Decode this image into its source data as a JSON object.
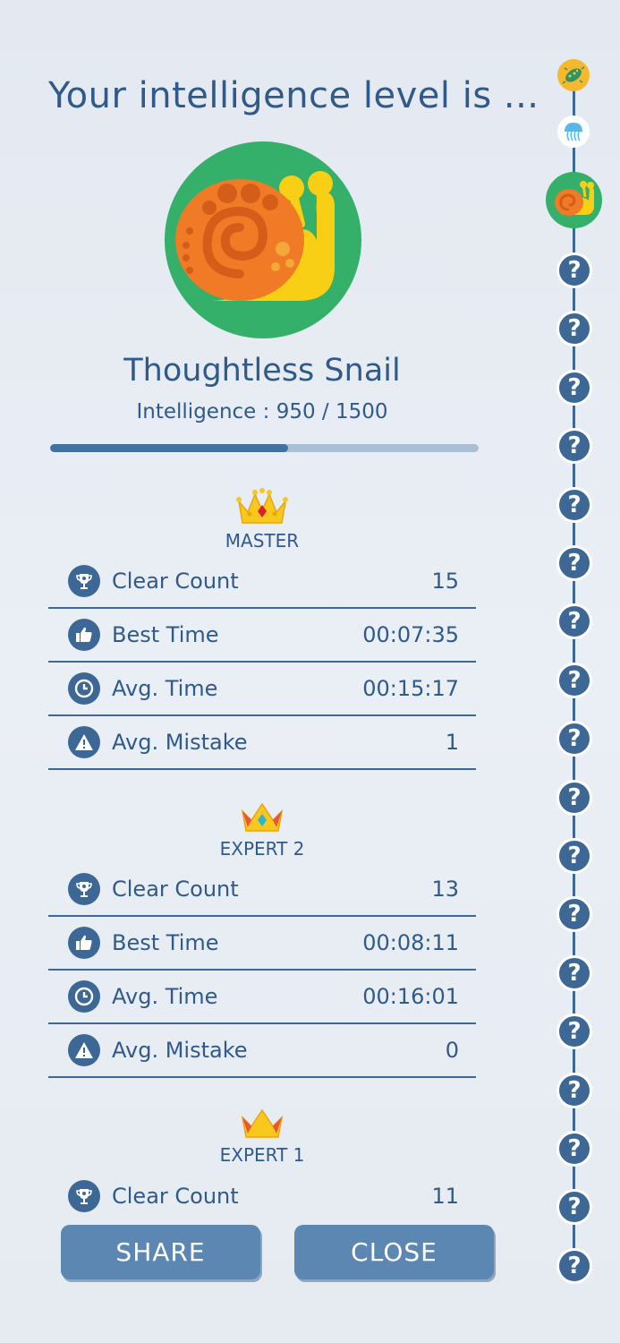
{
  "header": {
    "title": "Your intelligence level is ..."
  },
  "rank": {
    "name": "Thoughtless Snail",
    "intelligence_line": "Intelligence : 950 / 1500",
    "progress": 0.5556
  },
  "sections": [
    {
      "label": "MASTER",
      "crown": "master-crown",
      "stats": [
        {
          "icon": "trophy-icon",
          "label": "Clear Count",
          "value": "15"
        },
        {
          "icon": "thumbs-up-icon",
          "label": "Best Time",
          "value": "00:07:35"
        },
        {
          "icon": "clock-icon",
          "label": "Avg. Time",
          "value": "00:15:17"
        },
        {
          "icon": "warning-icon",
          "label": "Avg. Mistake",
          "value": "1"
        }
      ]
    },
    {
      "label": "EXPERT 2",
      "crown": "expert-2-crown",
      "stats": [
        {
          "icon": "trophy-icon",
          "label": "Clear Count",
          "value": "13"
        },
        {
          "icon": "thumbs-up-icon",
          "label": "Best Time",
          "value": "00:08:11"
        },
        {
          "icon": "clock-icon",
          "label": "Avg. Time",
          "value": "00:16:01"
        },
        {
          "icon": "warning-icon",
          "label": "Avg. Mistake",
          "value": "0"
        }
      ]
    },
    {
      "label": "EXPERT 1",
      "crown": "expert-1-crown",
      "stats": [
        {
          "icon": "trophy-icon",
          "label": "Clear Count",
          "value": "11"
        }
      ]
    }
  ],
  "buttons": {
    "share": "SHARE",
    "close": "CLOSE"
  },
  "level_track": {
    "levels": [
      "bacteria-icon",
      "jellyfish-icon",
      "snail-icon"
    ],
    "current_level": "snail-icon",
    "locked_glyph": "?",
    "locked_count": 18
  },
  "colors": {
    "primary": "#2f5a89",
    "accent": "#3d6896",
    "button": "#5b87b2",
    "avatar_bg": "#34b06b",
    "snail_shell": "#f07a25",
    "snail_body": "#f8cf14"
  }
}
